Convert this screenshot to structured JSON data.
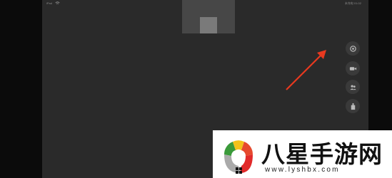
{
  "status_bar": {
    "carrier": "iPad",
    "right": "未充电 01:02"
  },
  "side_controls": [
    {
      "icon": "settings-icon"
    },
    {
      "icon": "camera-icon"
    },
    {
      "icon": "participants-icon"
    },
    {
      "icon": "share-icon"
    }
  ],
  "watermark": {
    "title": "八星手游网",
    "url": "www.lyshbx.com"
  },
  "colors": {
    "arrow": "#e8391f",
    "screen": "#2a2a2a",
    "button": "#3a3a3a"
  }
}
